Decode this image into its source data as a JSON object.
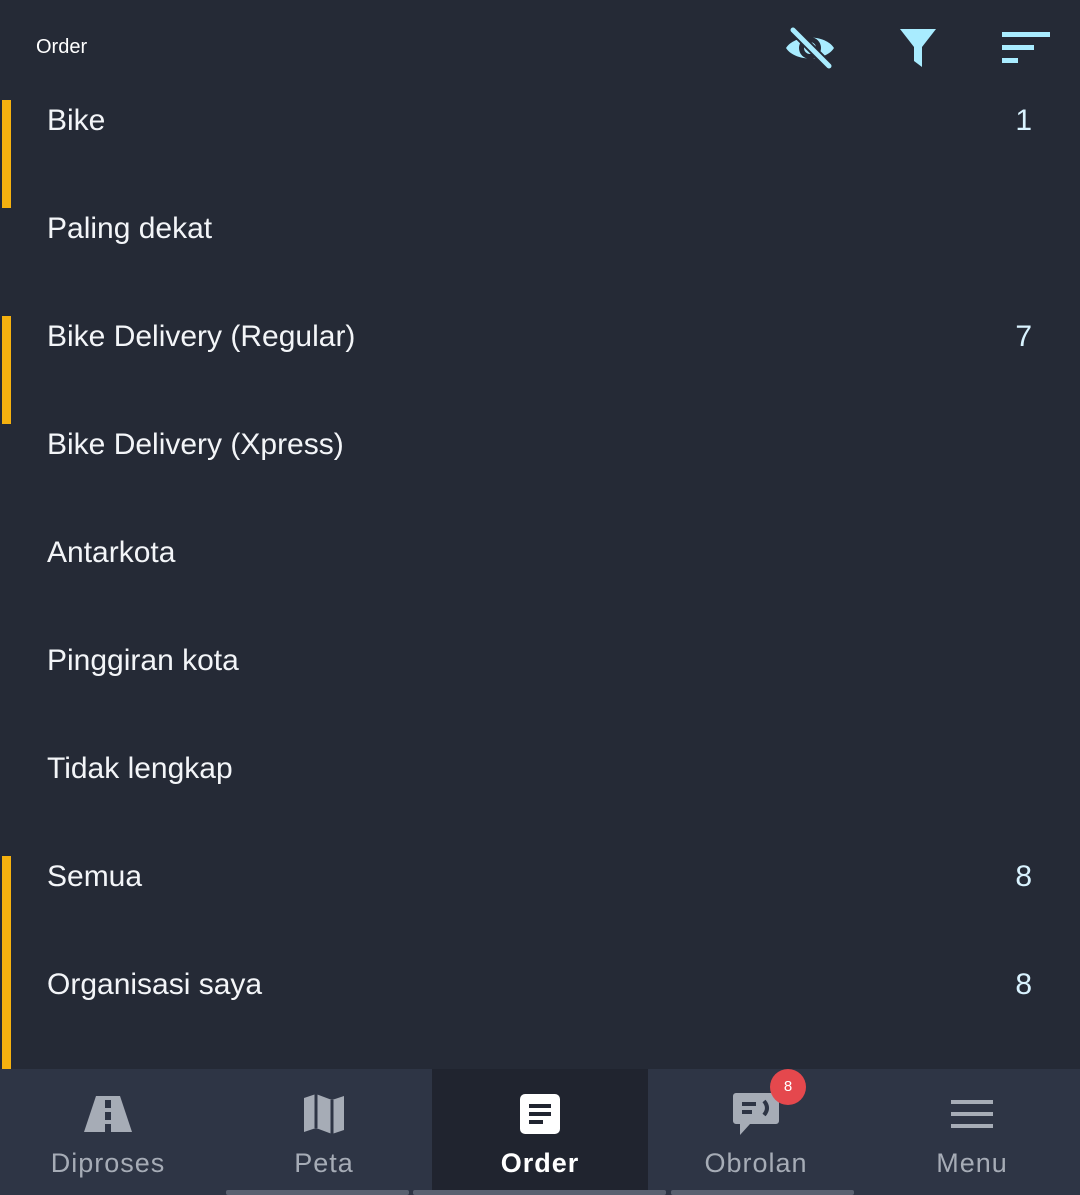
{
  "header": {
    "title": "Order",
    "icons": [
      "eye-off-icon",
      "filter-icon",
      "sort-icon"
    ]
  },
  "colors": {
    "background": "#252a36",
    "accent": "#f5b10f",
    "icon": "#a9ecff",
    "badge": "#e5484d",
    "nav_background": "#2e3545"
  },
  "list": {
    "items": [
      {
        "label": "Bike",
        "count": "1",
        "marked": true
      },
      {
        "label": "Paling dekat",
        "count": "",
        "marked": false
      },
      {
        "label": "Bike Delivery (Regular)",
        "count": "7",
        "marked": true
      },
      {
        "label": "Bike Delivery (Xpress)",
        "count": "",
        "marked": false
      },
      {
        "label": "Antarkota",
        "count": "",
        "marked": false
      },
      {
        "label": "Pinggiran kota",
        "count": "",
        "marked": false
      },
      {
        "label": "Tidak lengkap",
        "count": "",
        "marked": false
      },
      {
        "label": "Semua",
        "count": "8",
        "marked": true
      },
      {
        "label": "Organisasi saya",
        "count": "8",
        "marked": true
      }
    ]
  },
  "bottom_nav": {
    "items": [
      {
        "label": "Diproses",
        "icon": "road-icon",
        "active": false
      },
      {
        "label": "Peta",
        "icon": "map-icon",
        "active": false
      },
      {
        "label": "Order",
        "icon": "order-list-icon",
        "active": true
      },
      {
        "label": "Obrolan",
        "icon": "chat-icon",
        "active": false,
        "badge": "8"
      },
      {
        "label": "Menu",
        "icon": "menu-icon",
        "active": false
      }
    ]
  }
}
